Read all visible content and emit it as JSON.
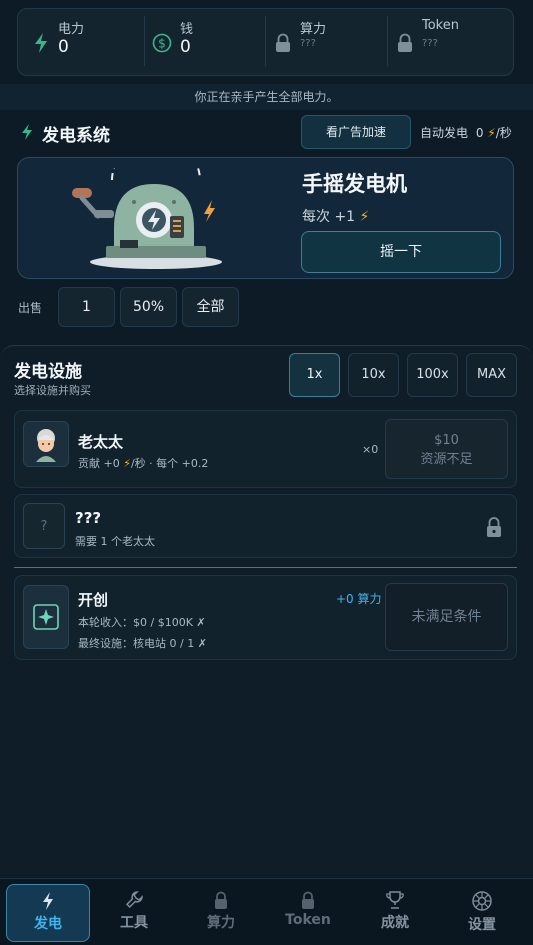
{
  "stats": [
    {
      "label": "电力",
      "value": "0",
      "icon": "lightning-icon"
    },
    {
      "label": "钱",
      "value": "0",
      "icon": "dollar-coin-icon"
    },
    {
      "label": "算力",
      "value": "???",
      "icon": "lock-icon"
    },
    {
      "label": "Token",
      "value": "???",
      "icon": "lock-icon"
    }
  ],
  "banner": "你正在亲手产生全部电力。",
  "gen_section": {
    "title": "发电系统",
    "ad_button": "看广告加速",
    "auto_label": "自动发电",
    "auto_value": "0",
    "auto_unit": "/秒"
  },
  "generator": {
    "name": "手摇发电机",
    "per_click": "每次 +1",
    "button": "摇一下"
  },
  "sell": {
    "label": "出售",
    "options": [
      "1",
      "50%",
      "全部"
    ]
  },
  "facilities": {
    "title": "发电设施",
    "subtitle": "选择设施并购买",
    "multipliers": [
      "1x",
      "10x",
      "100x",
      "MAX"
    ],
    "active_multiplier": "1x",
    "items": [
      {
        "name": "老太太",
        "desc_prefix": "贡献 +0",
        "desc_suffix": "/秒 · 每个 +0.2",
        "count": "×0",
        "price": "$10",
        "status": "资源不足"
      },
      {
        "name": "???",
        "desc": "需要 1 个老太太",
        "placeholder": "?"
      }
    ],
    "pioneer": {
      "name": "开创",
      "bonus": "+0 算力",
      "line1": "本轮收入：$0 / $100K ✗",
      "line2": "最终设施：核电站 0 / 1 ✗",
      "status": "未满足条件"
    }
  },
  "nav": [
    {
      "label": "发电",
      "icon": "lightning-icon",
      "active": true
    },
    {
      "label": "工具",
      "icon": "wrench-icon",
      "active": false
    },
    {
      "label": "算力",
      "icon": "lock-icon",
      "active": false
    },
    {
      "label": "Token",
      "icon": "lock-icon",
      "active": false
    },
    {
      "label": "成就",
      "icon": "trophy-icon",
      "active": false
    },
    {
      "label": "设置",
      "icon": "gear-icon",
      "active": false
    }
  ],
  "colors": {
    "accent": "#3fb4ee",
    "lightning": "#f5b400",
    "background": "#0d1b26"
  }
}
